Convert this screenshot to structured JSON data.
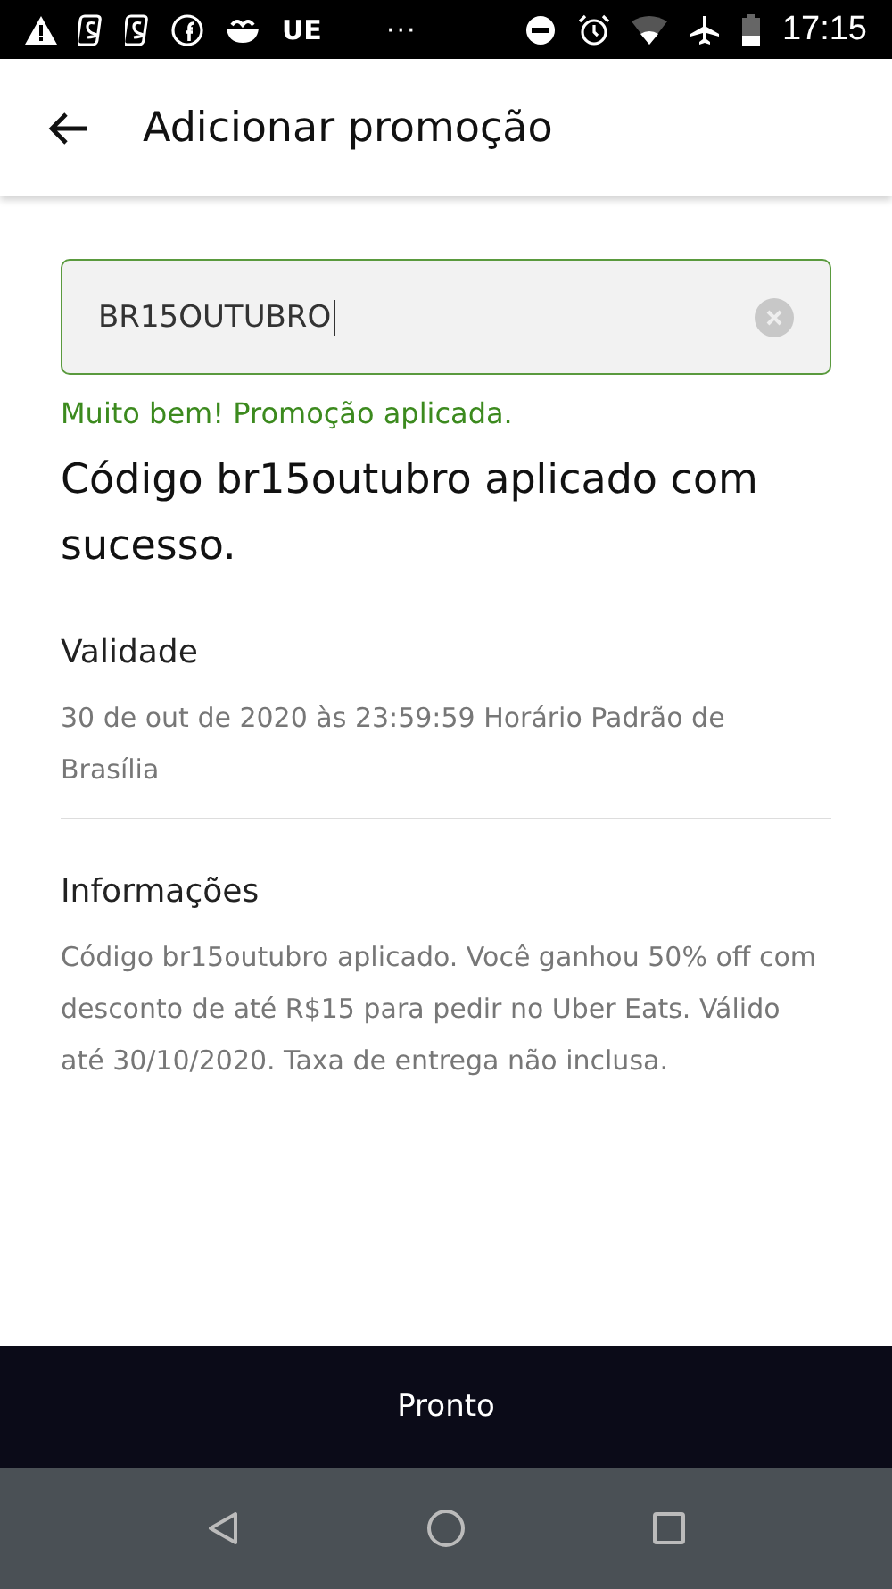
{
  "status_bar": {
    "carrier_text": "UE",
    "overflow": "···",
    "time": "17:15"
  },
  "app_bar": {
    "title": "Adicionar promoção"
  },
  "promo_field": {
    "value": "BR15OUTUBRO"
  },
  "success_message": "Muito bem! Promoção aplicada.",
  "headline": "Código br15outubro aplicado com sucesso.",
  "sections": [
    {
      "title": "Validade",
      "body": "30 de out de 2020 às 23:59:59 Horário Padrão de Brasília",
      "divider": true
    },
    {
      "title": "Informações",
      "body": "Código br15outubro aplicado. Você ganhou 50% off com desconto de até R$15 para pedir no Uber Eats. Válido até 30/10/2020. Taxa de entrega não inclusa.",
      "divider": false
    }
  ],
  "done_button": {
    "label": "Pronto"
  }
}
